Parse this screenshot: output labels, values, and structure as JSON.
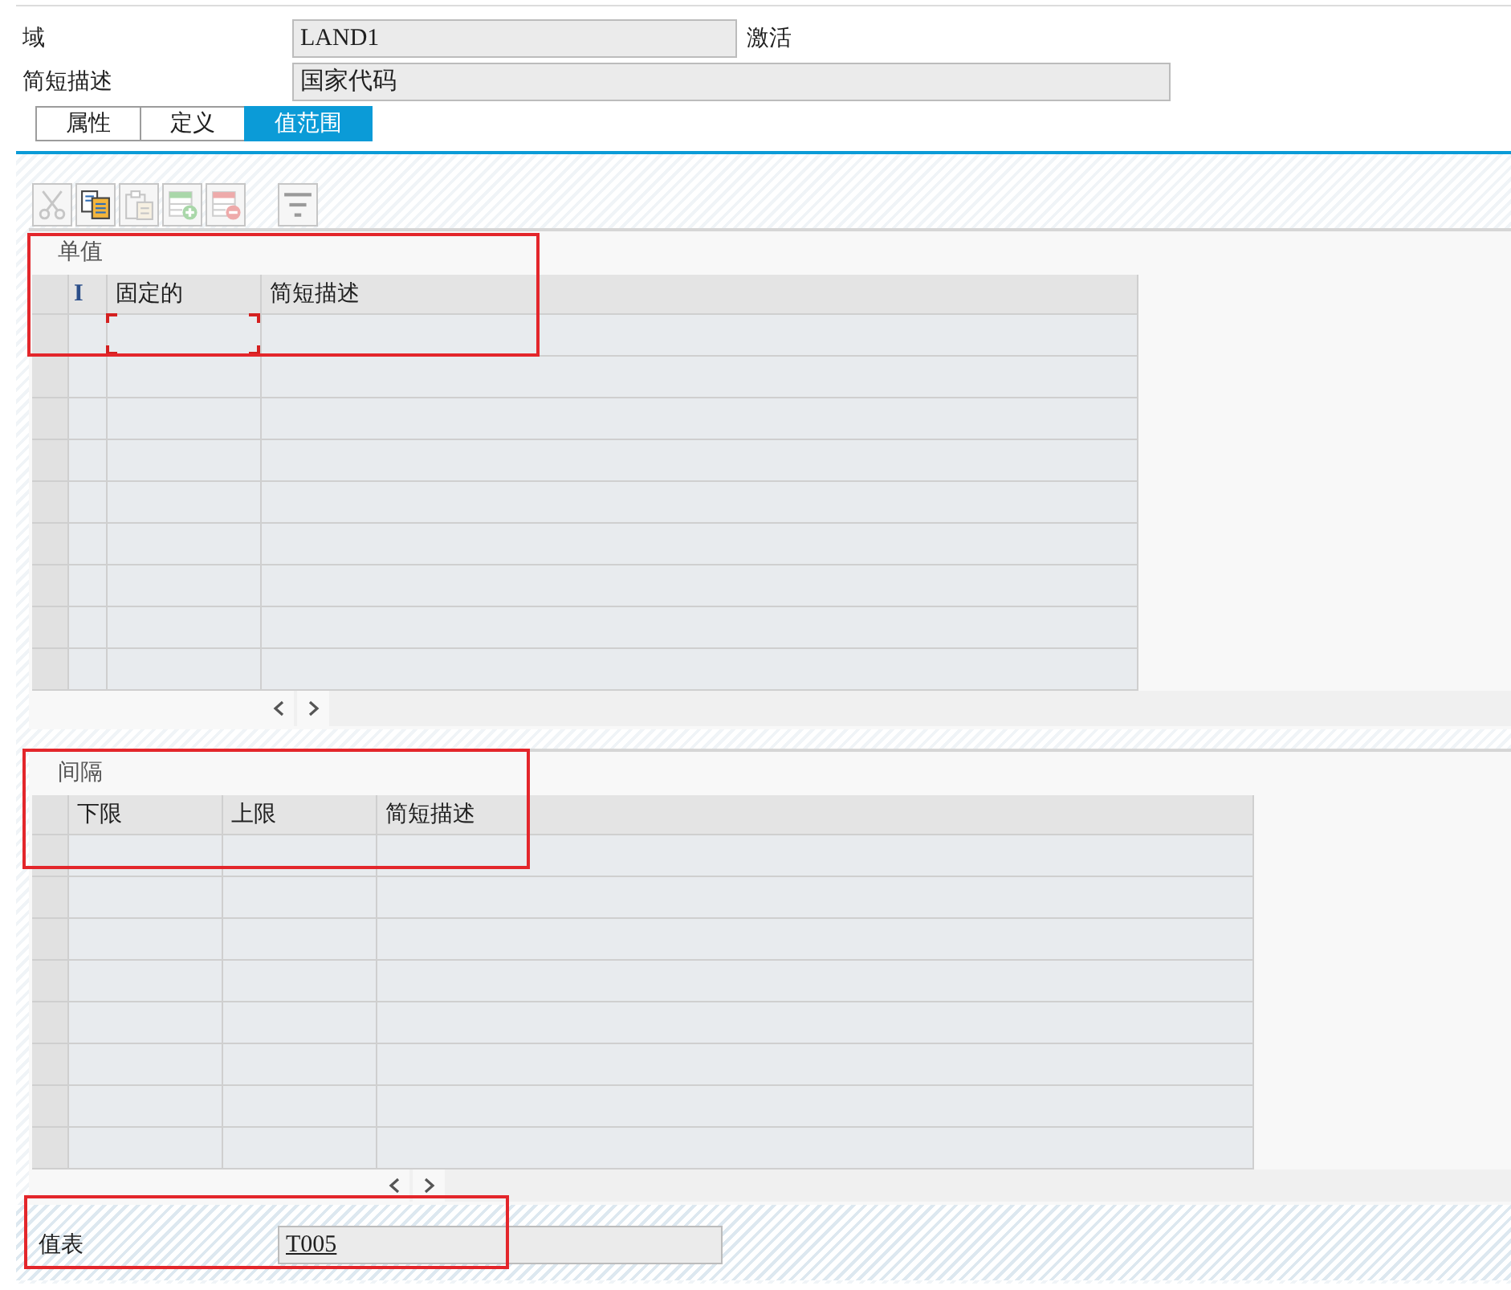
{
  "header_fields": [
    {
      "label": "域",
      "value": "LAND1",
      "status": "激活"
    },
    {
      "label": "简短描述",
      "value": "国家代码"
    }
  ],
  "tabs": [
    {
      "label": "属性",
      "selected": false
    },
    {
      "label": "定义",
      "selected": false
    },
    {
      "label": "值范围",
      "selected": true
    }
  ],
  "toolbar": [
    {
      "kind": "cut",
      "disabled": true
    },
    {
      "kind": "copy",
      "disabled": false
    },
    {
      "kind": "paste",
      "disabled": true
    },
    {
      "kind": "insert_row",
      "disabled": true
    },
    {
      "kind": "delete_row",
      "disabled": true
    },
    {
      "kind": "filter",
      "disabled": false
    }
  ],
  "single_values": {
    "title": "单值",
    "highlighted": true,
    "columns": [
      "I",
      "固定的",
      "简短描述"
    ],
    "rows": [
      {
        "selected": false,
        "focused": true
      },
      {
        "selected": false,
        "focused": false
      },
      {
        "selected": false,
        "focused": false
      },
      {
        "selected": false,
        "focused": false
      },
      {
        "selected": false,
        "focused": false
      },
      {
        "selected": false,
        "focused": false
      },
      {
        "selected": false,
        "focused": false
      },
      {
        "selected": false,
        "focused": false
      },
      {
        "selected": false,
        "focused": false
      }
    ]
  },
  "intervals": {
    "title": "间隔",
    "highlighted": true,
    "columns": [
      "下限",
      "上限",
      "简短描述"
    ],
    "rows": [
      {
        "selected": false
      },
      {
        "selected": false
      },
      {
        "selected": false
      },
      {
        "selected": false
      },
      {
        "selected": false
      },
      {
        "selected": false
      },
      {
        "selected": false
      },
      {
        "selected": false
      }
    ]
  },
  "value_table": {
    "label": "值表",
    "value": "T005",
    "highlighted": true
  }
}
